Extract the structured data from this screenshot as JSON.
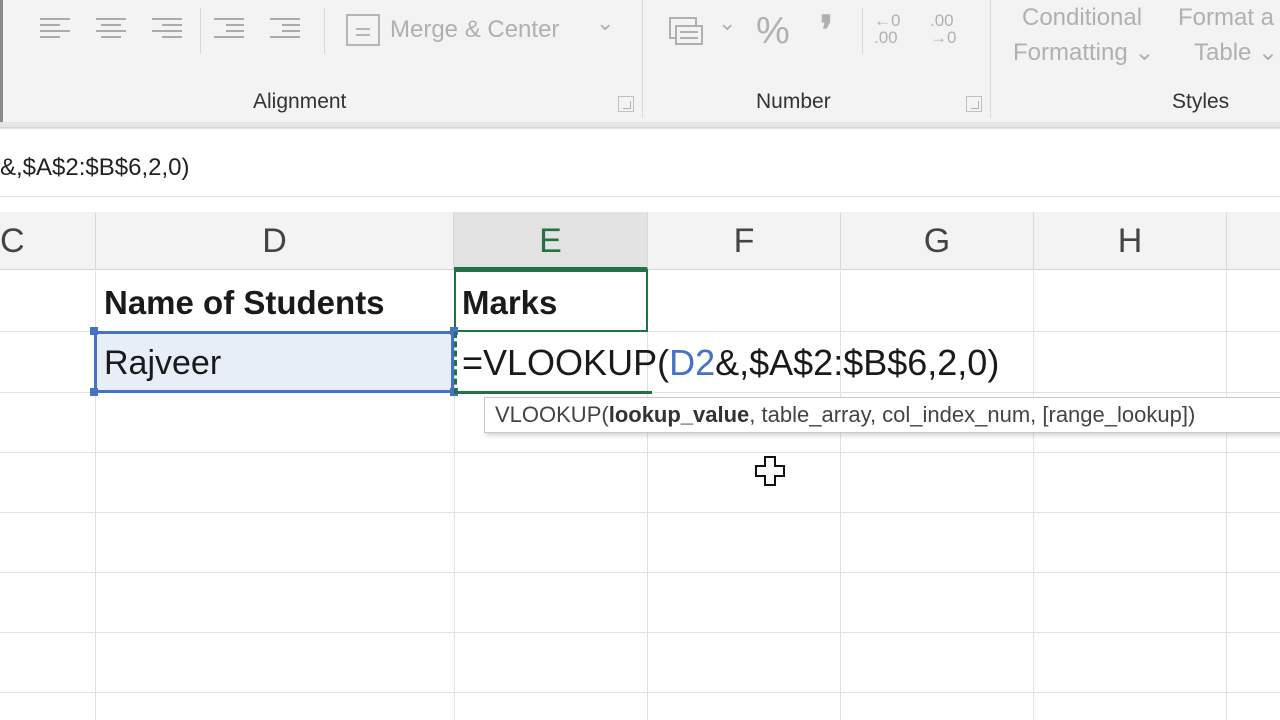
{
  "ribbon": {
    "merge_label": "Merge & Center",
    "merge_dropdown": "⌄",
    "percent_symbol": "%",
    "comma_symbol": "❜",
    "increase_decimal": "←0\n.00",
    "decrease_decimal": ".00\n→0",
    "conditional_formatting_line1": "Conditional",
    "conditional_formatting_line2": "Formatting ⌄",
    "format_table_line1": "Format a",
    "format_table_line2": "Table ⌄",
    "groups": {
      "alignment": "Alignment",
      "number": "Number",
      "styles": "Styles"
    }
  },
  "formula_bar": {
    "visible_text": "&,$A$2:$B$6,2,0)"
  },
  "columns": [
    {
      "label": "C"
    },
    {
      "label": "D"
    },
    {
      "label": "E"
    },
    {
      "label": "F"
    },
    {
      "label": "G"
    },
    {
      "label": "H"
    }
  ],
  "cells": {
    "d1": "Name of Students",
    "e1": "Marks",
    "d2": "Rajveer",
    "e2_prefix": "=VLOOKUP(",
    "e2_ref": "D2",
    "e2_suffix": "&,$A$2:$B$6,2,0)"
  },
  "tooltip": {
    "func": "VLOOKUP(",
    "arg1": "lookup_value",
    "rest": ", table_array, col_index_num, [range_lookup])"
  },
  "colors": {
    "accent_green": "#217346",
    "selection_blue": "#4472c4"
  }
}
